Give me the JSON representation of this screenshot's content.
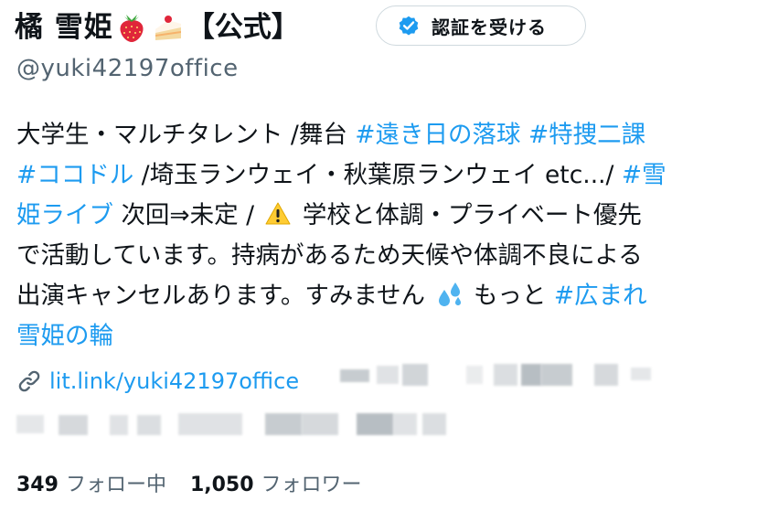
{
  "profile": {
    "name": "橘 雪姫",
    "name_tag": "【公式】",
    "name_emojis": [
      "strawberry-emoji",
      "cake-emoji"
    ],
    "handle": "@yuki42197office",
    "verify_button": {
      "label": "認証を受ける",
      "icon": "verified-badge-icon",
      "color": "#1d9bf0"
    }
  },
  "bio": {
    "line1_text": "大学生・マルチタレント /舞台",
    "line1_tag1": "#遠き日の落球",
    "line1_tag2": "#特捜二課",
    "line2_tag": "#ココドル",
    "line2_text": "/埼玉ランウェイ・秋葉原ランウェイ etc.../",
    "line2_tag_start": "#雪",
    "line3_tag_end": "姫ライブ",
    "line3_text": "次回⇒未定 /",
    "line3_warning_icon": "warning-icon",
    "line3_text2": "学校と体調・プライベート優先",
    "line4_text": "で活動しています。持病があるため天候や体調不良による",
    "line5_text": "出演キャンセルあります。すみません",
    "line5_sweat_icon": "sweat-droplets-icon",
    "line5_text2": "もっと",
    "line5_tag": "#広まれ",
    "line6_tag": "雪姫の輪"
  },
  "link": {
    "icon": "link-icon",
    "url": "lit.link/yuki42197office"
  },
  "stats": {
    "following_count": "349",
    "following_label": "フォロー中",
    "followers_count": "1,050",
    "followers_label": "フォロワー"
  },
  "colors": {
    "link": "#1d9bf0",
    "text": "#0f1419",
    "secondary": "#536471",
    "border": "#cfd9de"
  }
}
